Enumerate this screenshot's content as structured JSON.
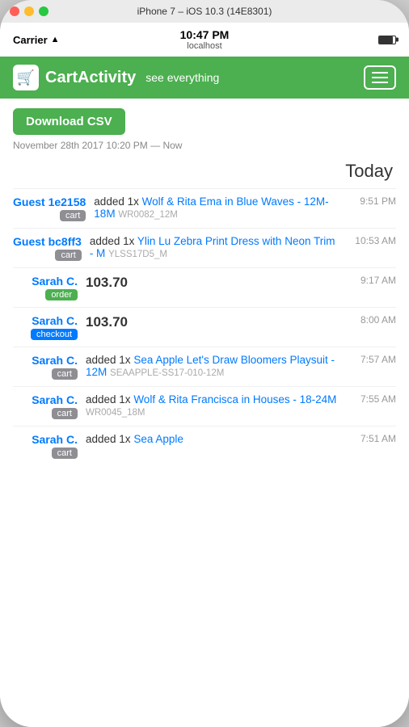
{
  "titleBar": {
    "title": "iPhone 7 – iOS 10.3 (14E8301)"
  },
  "statusBar": {
    "carrier": "Carrier",
    "wifi": "wifi",
    "time": "10:47 PM",
    "url": "localhost"
  },
  "header": {
    "iconEmoji": "🛒",
    "appName": "CartActivity",
    "subtitle": "see everything",
    "hamburgerLabel": "menu"
  },
  "content": {
    "downloadBtn": "Download CSV",
    "dateRange": "November 28th 2017 10:20 PM — Now",
    "sectionHeader": "Today",
    "activities": [
      {
        "user": "Guest 1e2158",
        "tag": "cart",
        "tagType": "cart",
        "time": "9:51 PM",
        "description": "added 1x",
        "productLink": "Wolf & Rita Ema in Blue Waves - 12M-18M",
        "sku": "WR0082_12M"
      },
      {
        "user": "Guest bc8ff3",
        "tag": "cart",
        "tagType": "cart",
        "time": "10:53 AM",
        "description": "added 1x",
        "productLink": "Ylin Lu Zebra Print Dress with Neon Trim - M",
        "sku": "YLSS17D5_M"
      },
      {
        "user": "Sarah C.",
        "tag": "order",
        "tagType": "order",
        "time": "9:17 AM",
        "amount": "103.70"
      },
      {
        "user": "Sarah C.",
        "tag": "checkout",
        "tagType": "checkout",
        "time": "8:00 AM",
        "amount": "103.70"
      },
      {
        "user": "Sarah C.",
        "tag": "cart",
        "tagType": "cart",
        "time": "7:57 AM",
        "description": "added 1x",
        "productLink": "Sea Apple Let's Draw Bloomers Playsuit - 12M",
        "sku": "SEAAPPLE-SS17-010-12M"
      },
      {
        "user": "Sarah C.",
        "tag": "cart",
        "tagType": "cart",
        "time": "7:55 AM",
        "description": "added 1x",
        "productLink": "Wolf & Rita Francisca in Houses - 18-24M",
        "sku": "WR0045_18M"
      },
      {
        "user": "Sarah C.",
        "tag": "cart",
        "tagType": "cart",
        "time": "7:51 AM",
        "description": "added 1x",
        "productLink": "Sea Apple",
        "sku": ""
      }
    ]
  }
}
